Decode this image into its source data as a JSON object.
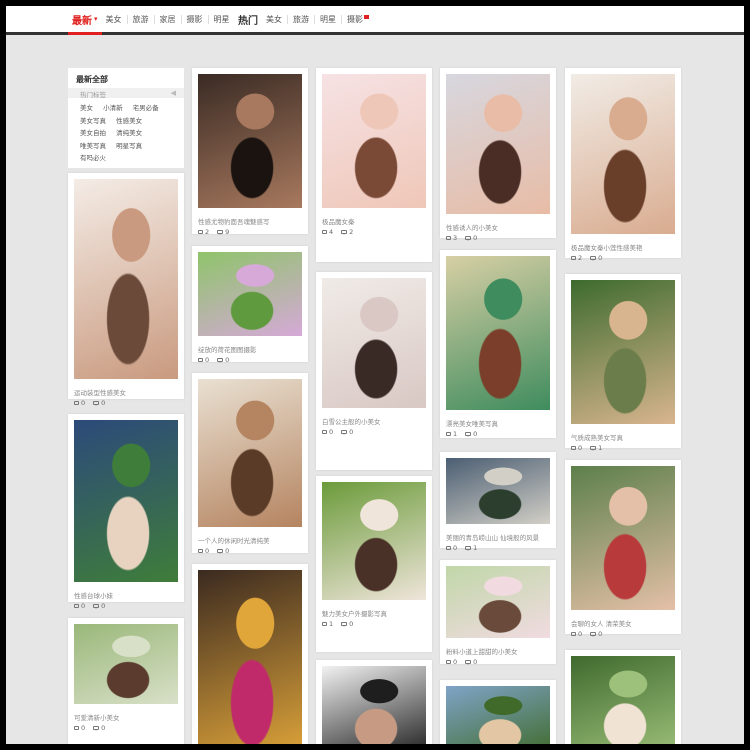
{
  "nav": {
    "section1": {
      "title": "最新",
      "arrow": "▾",
      "links": [
        "美女",
        "旅游",
        "家居",
        "摄影",
        "明星"
      ]
    },
    "section2": {
      "title": "热门",
      "links": [
        "美女",
        "旅游",
        "明星",
        "摄影"
      ]
    }
  },
  "category_box": {
    "title": "最新全部",
    "hot_label": "热门标签",
    "rows": [
      [
        "美女",
        "小清新",
        "宅男必备"
      ],
      [
        "美女写真",
        "性感美女"
      ],
      [
        "美女自拍",
        "清纯美女"
      ],
      [
        "唯美写真",
        "明星写真"
      ],
      [
        "有吗必火"
      ]
    ]
  },
  "cards": [
    {
      "col": 0,
      "caption": "运动装型性感美女",
      "likes": "0",
      "comments": "0"
    },
    {
      "col": 0,
      "caption": "性感台球小妹",
      "likes": "0",
      "comments": "0"
    },
    {
      "col": 0,
      "caption": "可爱清新小美女",
      "likes": "0",
      "comments": "0"
    },
    {
      "col": 1,
      "caption": "性感尤物豹面吾魂魅惑写",
      "likes": "2",
      "comments": "9"
    },
    {
      "col": 1,
      "caption": "绽放的荷花图图摄影",
      "likes": "0",
      "comments": "0"
    },
    {
      "col": 1,
      "caption": "一个人的休闲时光清纯美",
      "likes": "0",
      "comments": "0"
    },
    {
      "col": 1,
      "caption": "",
      "likes": "",
      "comments": ""
    },
    {
      "col": 2,
      "caption": "极品魔女秦",
      "likes": "4",
      "comments": "2"
    },
    {
      "col": 2,
      "caption": "白雪公主般的小美女",
      "likes": "0",
      "comments": "0"
    },
    {
      "col": 2,
      "caption": "魅力美女户外摄影写真",
      "likes": "1",
      "comments": "0"
    },
    {
      "col": 2,
      "caption": "",
      "likes": "",
      "comments": ""
    },
    {
      "col": 3,
      "caption": "性感诱人的小美女",
      "likes": "3",
      "comments": "0"
    },
    {
      "col": 3,
      "caption": "漂亮美女唯美写真",
      "likes": "1",
      "comments": "0"
    },
    {
      "col": 3,
      "caption": "美丽的青岛崂山山 仙境般的风景",
      "likes": "0",
      "comments": "1"
    },
    {
      "col": 3,
      "caption": "粉料小道上甜甜的小美女",
      "likes": "0",
      "comments": "0"
    },
    {
      "col": 3,
      "caption": "",
      "likes": "",
      "comments": ""
    },
    {
      "col": 4,
      "caption": "极品魔女秦小莲性感美艳",
      "likes": "2",
      "comments": "0"
    },
    {
      "col": 4,
      "caption": "气质成熟美女写真",
      "likes": "0",
      "comments": "1"
    },
    {
      "col": 4,
      "caption": "会聊的女人 清荣美女",
      "likes": "0",
      "comments": "0"
    },
    {
      "col": 4,
      "caption": "",
      "likes": "",
      "comments": ""
    }
  ],
  "photo_palettes": [
    [
      "#f4ece6",
      "#c99a7f",
      "#6b4a3a"
    ],
    [
      "#2c4a7a",
      "#3f7d3a",
      "#e7d3c0"
    ],
    [
      "#9ab87a",
      "#d9e0c8",
      "#5a3b2e"
    ],
    [
      "#3a2b24",
      "#a8795e",
      "#1a1310"
    ],
    [
      "#8ec46a",
      "#d6a9d8",
      "#5f9a3e"
    ],
    [
      "#e9e0d2",
      "#b58460",
      "#5a3b27"
    ],
    [
      "#3b2a20",
      "#e1a63a",
      "#c02a6a"
    ],
    [
      "#f6e2e4",
      "#efc7b8",
      "#7a4a36"
    ],
    [
      "#f0ebe7",
      "#d9c8c4",
      "#3a2a26"
    ],
    [
      "#6b9b3a",
      "#efe5da",
      "#4a3128"
    ],
    [
      "#f2f2f2",
      "#1e1e1e",
      "#c79b83"
    ],
    [
      "#d7d7df",
      "#e8bca6",
      "#4a2d24"
    ],
    [
      "#d7cfa4",
      "#3f8c5e",
      "#7a3e2a"
    ],
    [
      "#4b5e73",
      "#d2cfc6",
      "#2c3f2e"
    ],
    [
      "#c0d7a8",
      "#f1dbe1",
      "#6a4a3a"
    ],
    [
      "#7fa4c8",
      "#3f6a2a",
      "#e3c7a4"
    ],
    [
      "#f1ece6",
      "#d9ac90",
      "#6a3f2a"
    ],
    [
      "#3d6b2e",
      "#d9b58f",
      "#6b7d4a"
    ],
    [
      "#5c7f4a",
      "#e4c0a8",
      "#b83a3a"
    ],
    [
      "#3f6a2e",
      "#9dc07a",
      "#f1e3d4"
    ]
  ]
}
